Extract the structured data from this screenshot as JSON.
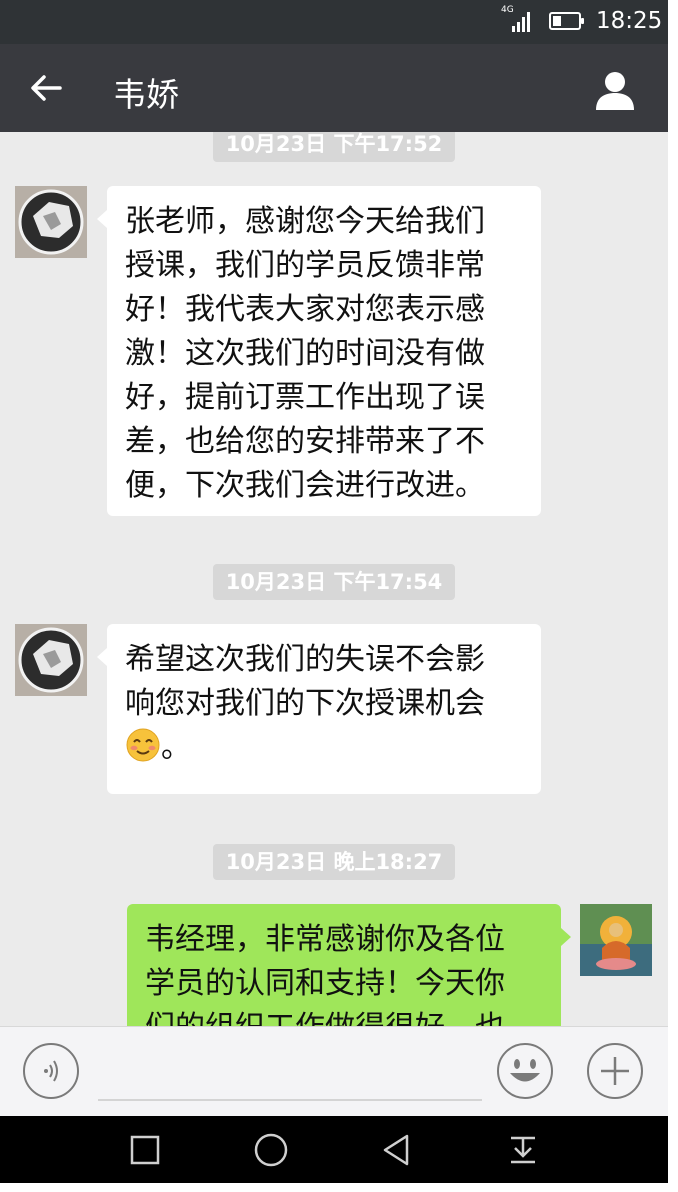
{
  "status_bar": {
    "network": "4G",
    "time": "18:25",
    "battery_level": 0.35,
    "signal_level": 4
  },
  "header": {
    "back_icon": "arrow-left-icon",
    "title": "韦娇",
    "profile_icon": "person-icon"
  },
  "messages": [
    {
      "type": "timestamp",
      "text": "10月23日 下午17:52"
    },
    {
      "type": "incoming",
      "lines": [
        "张老师，感谢您今天给我们",
        "授课，我们的学员反馈非常",
        "好！我代表大家对您表示感",
        "激！这次我们的时间没有做",
        "好，提前订票工作出现了误",
        "差，也给您的安排带来了不",
        "便，下次我们会进行改进。"
      ]
    },
    {
      "type": "timestamp",
      "text": "10月23日 下午17:54"
    },
    {
      "type": "incoming",
      "lines": [
        "希望这次我们的失误不会影",
        "响您对我们的下次授课机会"
      ],
      "emoji": "blushing-smile-emoji",
      "tail": "。"
    },
    {
      "type": "timestamp",
      "text": "10月23日 晚上18:27"
    },
    {
      "type": "outgoing",
      "lines": [
        "韦经理，非常感谢你及各位",
        "学员的认同和支持！今天你",
        "们的组织工作做得很好，也"
      ]
    }
  ],
  "input_bar": {
    "voice_icon": "voice-icon",
    "emoji_icon": "smiley-icon",
    "plus_icon": "plus-icon"
  },
  "nav_bar": {
    "icons": [
      "recent-apps-icon",
      "home-icon",
      "back-triangle-icon",
      "notification-pull-icon"
    ]
  },
  "colors": {
    "status_bar": "#2f3336",
    "title_bar": "#393a3f",
    "chat_bg": "#ebebeb",
    "incoming_bubble": "#ffffff",
    "outgoing_bubble": "#9fe65a",
    "timestamp_bg": "#d7d7d7"
  }
}
